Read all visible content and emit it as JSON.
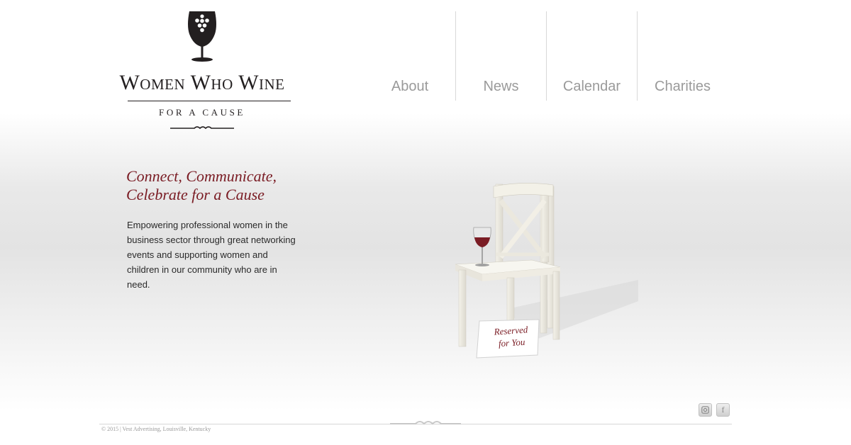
{
  "brand": {
    "title": "Women Who Wine",
    "subtitle": "FOR A CAUSE",
    "icon": "wine-glass-grapes-icon"
  },
  "nav": {
    "items": [
      {
        "label": "About"
      },
      {
        "label": "News"
      },
      {
        "label": "Calendar"
      },
      {
        "label": "Charities"
      }
    ]
  },
  "hero": {
    "headline_line1": "Connect, Communicate,",
    "headline_line2": "Celebrate for a Cause",
    "description": "Empowering professional women in the business sector through great networking events and supporting women and children in our community who are in need.",
    "card_line1": "Reserved",
    "card_line2": "for You"
  },
  "footer": {
    "copyright": "© 2015 | Vest Advertising, Louisville, Kentucky",
    "social": [
      {
        "icon": "instagram-icon"
      },
      {
        "icon": "facebook-icon",
        "glyph": "f"
      }
    ]
  },
  "colors": {
    "accent": "#7a1c24",
    "nav_text": "#9a9a9a",
    "logo": "#231f20"
  }
}
